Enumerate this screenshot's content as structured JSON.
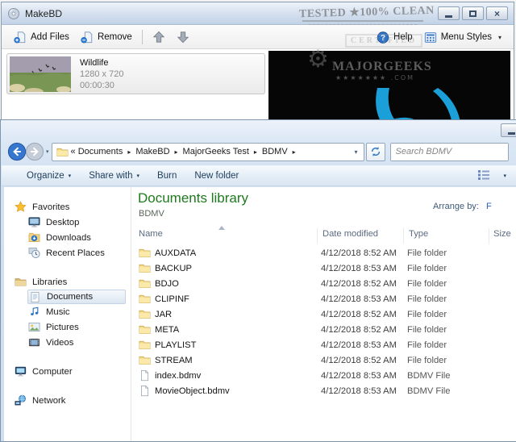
{
  "makebd": {
    "title": "MakeBD",
    "toolbar": {
      "add_files": "Add Files",
      "remove": "Remove",
      "help": "Help",
      "menu_styles": "Menu Styles"
    },
    "clip": {
      "name": "Wildlife",
      "resolution": "1280 x 720",
      "duration": "00:00:30"
    }
  },
  "watermark": {
    "line1": "TESTED ★100% CLEAN",
    "line2": "CERTIFIED",
    "line3": "MAJORGEEKS",
    "line4": "★★★★★★★ .COM"
  },
  "explorer": {
    "breadcrumb": {
      "segments": [
        "« Documents",
        "MakeBD",
        "MajorGeeks Test",
        "BDMV"
      ]
    },
    "search": {
      "placeholder": "Search BDMV"
    },
    "toolbar": {
      "items": [
        "Organize",
        "Share with",
        "Burn",
        "New folder"
      ]
    },
    "library": {
      "title": "Documents library",
      "subtitle": "BDMV",
      "arrange_by_label": "Arrange by:",
      "arrange_by_value": "F"
    },
    "columns": [
      "Name",
      "Date modified",
      "Type",
      "Size"
    ],
    "sidebar": {
      "items": [
        {
          "icon": "star",
          "label": "Favorites",
          "level": 0
        },
        {
          "icon": "desktop",
          "label": "Desktop",
          "level": 1
        },
        {
          "icon": "downloads",
          "label": "Downloads",
          "level": 1
        },
        {
          "icon": "recent",
          "label": "Recent Places",
          "level": 1
        },
        {
          "icon": "libraries",
          "label": "Libraries",
          "level": 0,
          "gap": true
        },
        {
          "icon": "documents",
          "label": "Documents",
          "level": 1,
          "selected": true
        },
        {
          "icon": "music",
          "label": "Music",
          "level": 1
        },
        {
          "icon": "pictures",
          "label": "Pictures",
          "level": 1
        },
        {
          "icon": "videos",
          "label": "Videos",
          "level": 1
        },
        {
          "icon": "computer",
          "label": "Computer",
          "level": 0,
          "gap": true
        },
        {
          "icon": "network",
          "label": "Network",
          "level": 0,
          "gap": true
        }
      ]
    },
    "files": [
      {
        "icon": "folder",
        "name": "AUXDATA",
        "date": "4/12/2018 8:52 AM",
        "type": "File folder",
        "size": ""
      },
      {
        "icon": "folder",
        "name": "BACKUP",
        "date": "4/12/2018 8:53 AM",
        "type": "File folder",
        "size": ""
      },
      {
        "icon": "folder",
        "name": "BDJO",
        "date": "4/12/2018 8:52 AM",
        "type": "File folder",
        "size": ""
      },
      {
        "icon": "folder",
        "name": "CLIPINF",
        "date": "4/12/2018 8:53 AM",
        "type": "File folder",
        "size": ""
      },
      {
        "icon": "folder",
        "name": "JAR",
        "date": "4/12/2018 8:52 AM",
        "type": "File folder",
        "size": ""
      },
      {
        "icon": "folder",
        "name": "META",
        "date": "4/12/2018 8:52 AM",
        "type": "File folder",
        "size": ""
      },
      {
        "icon": "folder",
        "name": "PLAYLIST",
        "date": "4/12/2018 8:53 AM",
        "type": "File folder",
        "size": ""
      },
      {
        "icon": "folder",
        "name": "STREAM",
        "date": "4/12/2018 8:52 AM",
        "type": "File folder",
        "size": ""
      },
      {
        "icon": "file",
        "name": "index.bdmv",
        "date": "4/12/2018 8:53 AM",
        "type": "BDMV File",
        "size": ""
      },
      {
        "icon": "file",
        "name": "MovieObject.bdmv",
        "date": "4/12/2018 8:53 AM",
        "type": "BDMV File",
        "size": ""
      }
    ]
  },
  "colors": {
    "library_title_green": "#1e7a1e",
    "bluray_blue": "#1b9fd8",
    "titlebar_blue": "#c2d2e6"
  }
}
